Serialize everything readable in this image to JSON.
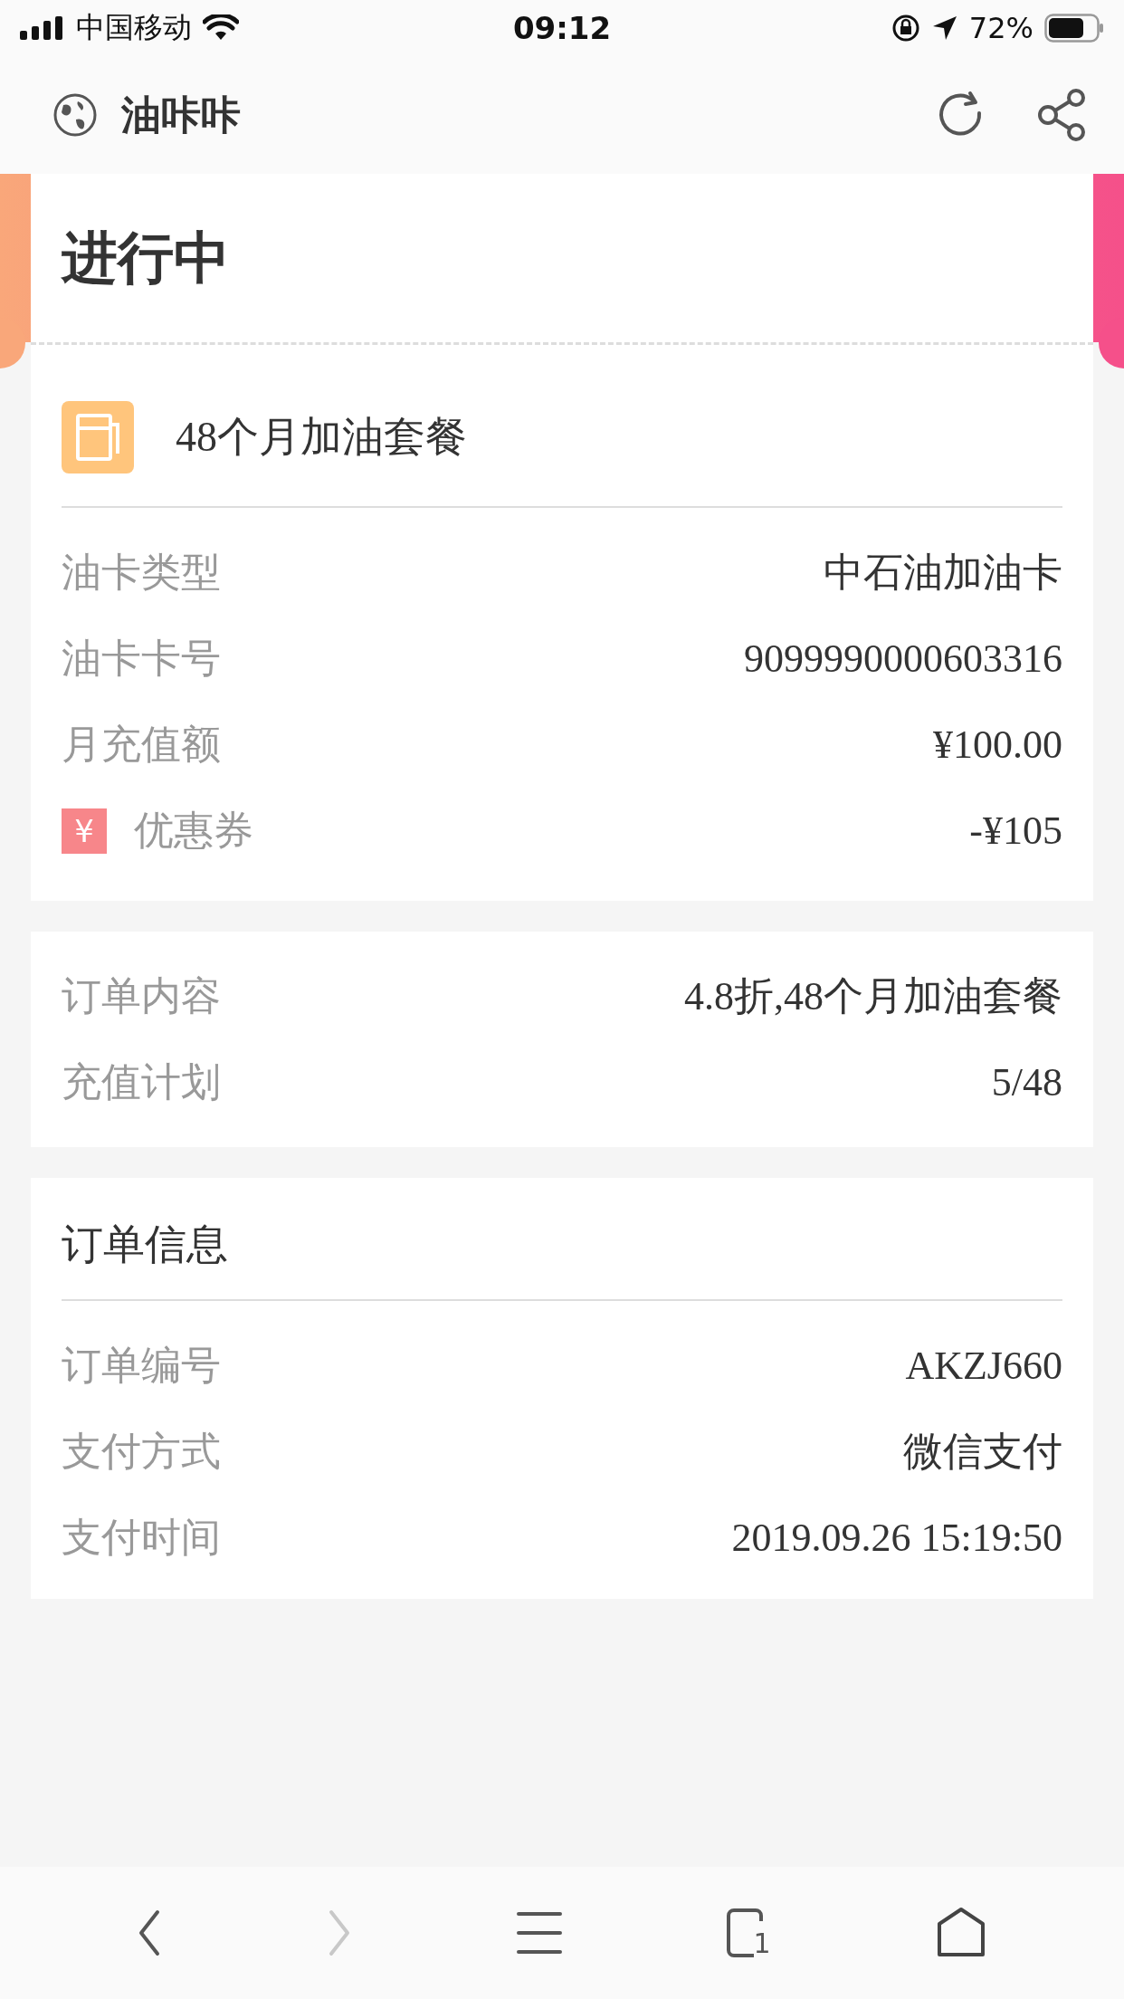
{
  "status_bar": {
    "carrier": "中国移动",
    "time": "09:12",
    "battery": "72%"
  },
  "nav": {
    "title": "油咔咔"
  },
  "status_title": "进行中",
  "package": {
    "name": "48个月加油套餐",
    "rows": [
      {
        "kind": "plain",
        "label": "油卡类型",
        "value": "中石油加油卡"
      },
      {
        "kind": "plain",
        "label": "油卡卡号",
        "value": "9099990000603316"
      },
      {
        "kind": "plain",
        "label": "月充值额",
        "value": "¥100.00"
      },
      {
        "kind": "coupon",
        "icon": "¥",
        "label": "优惠券",
        "value": "-¥105"
      }
    ]
  },
  "order_content": {
    "rows": [
      {
        "label": "订单内容",
        "value": "4.8折,48个月加油套餐"
      },
      {
        "label": "充值计划",
        "value": "5/48"
      }
    ]
  },
  "order_info": {
    "title": "订单信息",
    "rows": [
      {
        "label": "订单编号",
        "value": "AKZJ660"
      },
      {
        "label": "支付方式",
        "value": "微信支付"
      },
      {
        "label": "支付时间",
        "value": "2019.09.26 15:19:50"
      }
    ]
  },
  "toolbar": {
    "back": {
      "disabled": false
    },
    "forward": {
      "disabled": true
    },
    "tab_count": "1"
  }
}
